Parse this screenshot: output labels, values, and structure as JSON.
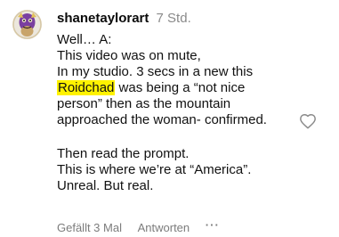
{
  "comment": {
    "username": "shanetaylorart",
    "timestamp": "7 Std.",
    "body": {
      "line1": "Well… A:",
      "line2": "This video was on mute,",
      "line3": "In my studio. 3 secs in a new this",
      "line4_highlight": "Roidchad",
      "line4_rest": " was being a “not nice",
      "line5": "person” then as the mountain",
      "line6": "approached the woman- confirmed.",
      "line7": "Then read the prompt.",
      "line8": "This is where we’re at “America”.",
      "line9": "Unreal. But real."
    },
    "footer": {
      "likes_label": "Gefällt 3 Mal",
      "reply_label": "Antworten",
      "more_label": "···"
    },
    "icons": {
      "like": "heart-outline-icon",
      "more": "more-options-icon"
    },
    "colors": {
      "highlight": "#fff200",
      "muted": "#8a8a8a"
    }
  }
}
